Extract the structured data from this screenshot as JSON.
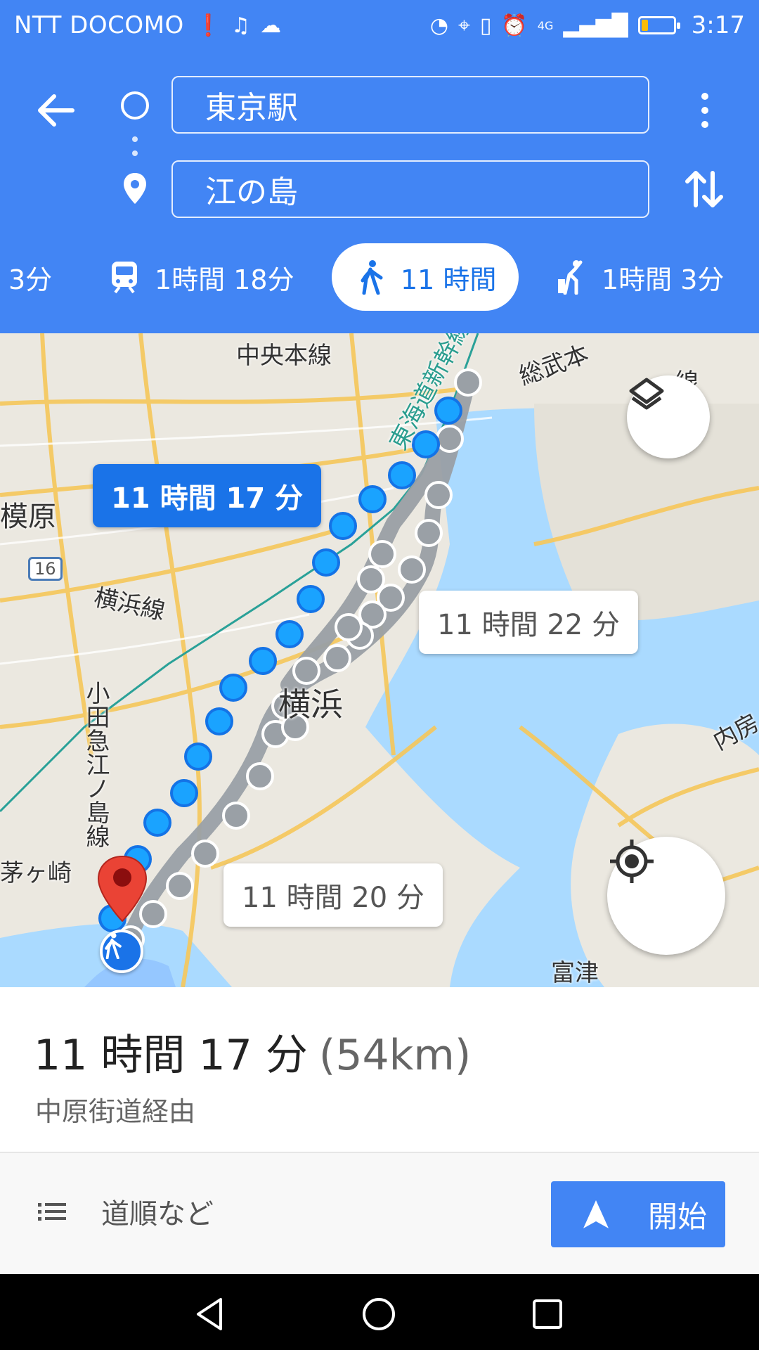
{
  "status_bar": {
    "carrier": "NTT DOCOMO",
    "time": "3:17",
    "network": "4G",
    "battery_level": 0.2,
    "left_icons": [
      "alert-icon",
      "music-icon",
      "cloud-icon"
    ],
    "right_icons": [
      "data-saver-icon",
      "location-icon",
      "vibrate-icon",
      "alarm-icon",
      "signal-icon",
      "battery-icon"
    ]
  },
  "header": {
    "origin": "東京駅",
    "destination": "江の島"
  },
  "modes": [
    {
      "icon": "car-icon",
      "label": "3分",
      "selected": false
    },
    {
      "icon": "train-icon",
      "label": "1時間 18分",
      "selected": false
    },
    {
      "icon": "walk-icon",
      "label": "11 時間",
      "selected": true
    },
    {
      "icon": "ride-hail-icon",
      "label": "1時間 3分",
      "selected": false
    }
  ],
  "map": {
    "labels": {
      "chuo_line": "中央本線",
      "sobu_line": "総武本",
      "sen": "線",
      "sagamihara": "模原",
      "route16": "16",
      "yokohama_line": "横浜線",
      "odakyu_line": "小田急江ノ島線",
      "chigasaki": "茅ヶ崎",
      "yokohama": "横浜",
      "tokaido_shinkansen": "東海道新幹線",
      "uchiboso": "内房",
      "futtsu": "富津"
    },
    "route_callouts": {
      "selected": "11 時間 17 分",
      "alt1": "11 時間 22 分",
      "alt2": "11 時間 20 分"
    },
    "accent_route_color": "#1aa3ff",
    "alt_route_color": "#9aa0a6",
    "pin_color": "#ea4335"
  },
  "summary": {
    "duration": "11 時間 17 分",
    "distance": "(54km)",
    "via": "中原街道経由"
  },
  "actions": {
    "steps_label": "道順など",
    "start_label": "開始"
  }
}
